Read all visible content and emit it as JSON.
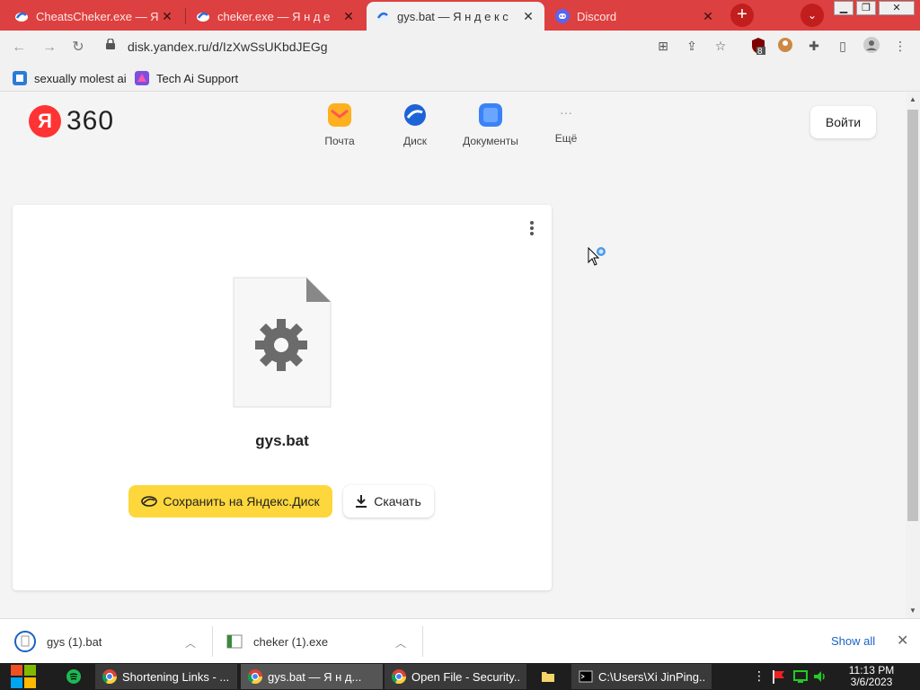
{
  "browser": {
    "tabs": [
      {
        "title": "CheatsCheker.exe — Я",
        "active": false
      },
      {
        "title": "cheker.exe — Я н д е",
        "active": false
      },
      {
        "title": "gys.bat — Я н д е к с",
        "active": true
      },
      {
        "title": "Discord",
        "active": false
      }
    ],
    "close_glyph": "✕",
    "new_tab_glyph": "+",
    "tab_search_glyph": "⌄",
    "url": "disk.yandex.ru/d/IzXwSsUKbdJEGg",
    "extension_badge": "8"
  },
  "bookmarks": [
    {
      "label": "sexually molest ai"
    },
    {
      "label": "Tech Ai Support"
    }
  ],
  "header": {
    "logo_letter": "Я",
    "logo_text": "360",
    "services": [
      {
        "label": "Почта"
      },
      {
        "label": "Диск"
      },
      {
        "label": "Документы"
      },
      {
        "label": "Ещё"
      }
    ],
    "login_label": "Войти"
  },
  "file": {
    "name": "gys.bat",
    "save_label": "Сохранить на Яндекс.Диск",
    "download_label": "Скачать"
  },
  "downloads": {
    "items": [
      {
        "name": "gys (1).bat"
      },
      {
        "name": "cheker (1).exe"
      }
    ],
    "show_all_label": "Show all",
    "close_glyph": "✕"
  },
  "taskbar": {
    "tasks": [
      {
        "label": "Shortening Links - ..."
      },
      {
        "label": "gys.bat — Я н д..."
      },
      {
        "label": "Open File - Security..."
      },
      {
        "label": ""
      },
      {
        "label": "C:\\Users\\Xi JinPing..."
      }
    ],
    "time": "11:13 PM",
    "date": "3/6/2023"
  },
  "colors": {
    "tabstrip": "#dd4040",
    "accent_yellow": "#fdd73b",
    "link_blue": "#1a62c4"
  }
}
